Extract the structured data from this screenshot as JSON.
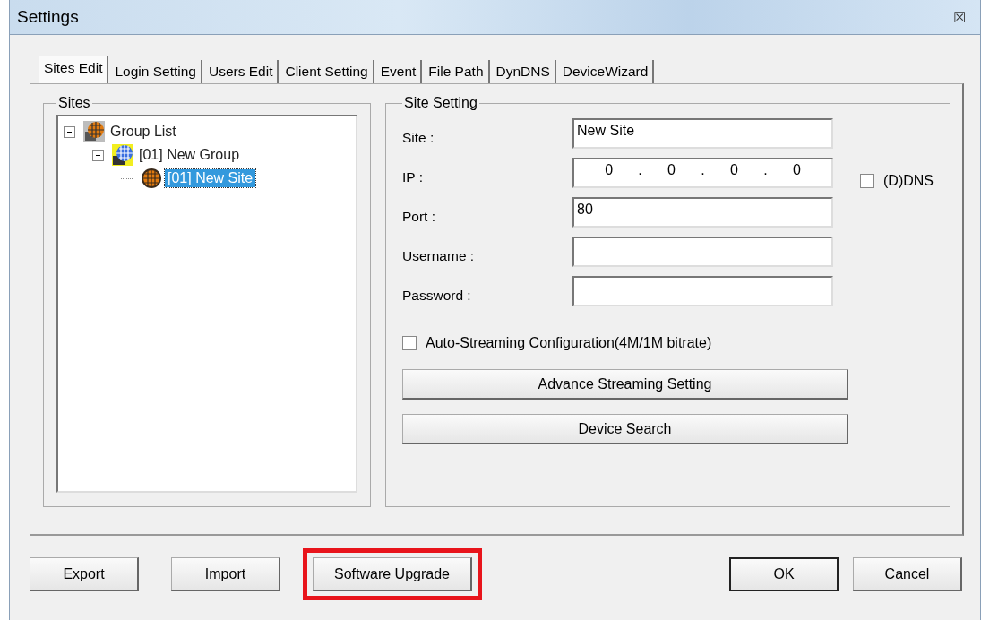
{
  "window": {
    "title": "Settings",
    "close": "☒"
  },
  "tabs": [
    {
      "label": "Sites Edit",
      "selected": true
    },
    {
      "label": "Login Setting",
      "selected": false
    },
    {
      "label": "Users Edit",
      "selected": false
    },
    {
      "label": "Client Setting",
      "selected": false
    },
    {
      "label": "Event",
      "selected": false
    },
    {
      "label": "File Path",
      "selected": false
    },
    {
      "label": "DynDNS",
      "selected": false
    },
    {
      "label": "DeviceWizard",
      "selected": false
    }
  ],
  "sites": {
    "title": "Sites",
    "tree": [
      {
        "label": "Group List",
        "kind": "group-list",
        "expanded": true,
        "selected": false,
        "children": [
          {
            "label": "[01] New Group",
            "kind": "group",
            "expanded": true,
            "selected": false,
            "children": [
              {
                "label": "[01] New Site",
                "kind": "site",
                "selected": true
              }
            ]
          }
        ]
      }
    ]
  },
  "site_setting": {
    "title": "Site Setting",
    "fields": [
      {
        "label": "Site :",
        "kind": "text",
        "value": "New Site"
      },
      {
        "label": "IP :",
        "kind": "ip",
        "octets": [
          "0",
          "0",
          "0",
          "0"
        ],
        "separator": ".",
        "side_checkbox": {
          "label": "(D)DNS",
          "checked": false
        }
      },
      {
        "label": "Port :",
        "kind": "text",
        "value": "80"
      },
      {
        "label": "Username :",
        "kind": "text"
      },
      {
        "label": "Password :",
        "kind": "text"
      }
    ],
    "auto_streaming": {
      "label": "Auto-Streaming Configuration(4M/1M bitrate)",
      "checked": false
    },
    "buttons": [
      "Advance Streaming Setting",
      "Device Search"
    ]
  },
  "footer": {
    "left_buttons": [
      {
        "label": "Export",
        "highlighted": false
      },
      {
        "label": "Import",
        "highlighted": false
      },
      {
        "label": "Software Upgrade",
        "highlighted": true
      }
    ],
    "right_buttons": [
      {
        "label": "OK",
        "default": true
      },
      {
        "label": "Cancel",
        "default": false
      }
    ]
  }
}
